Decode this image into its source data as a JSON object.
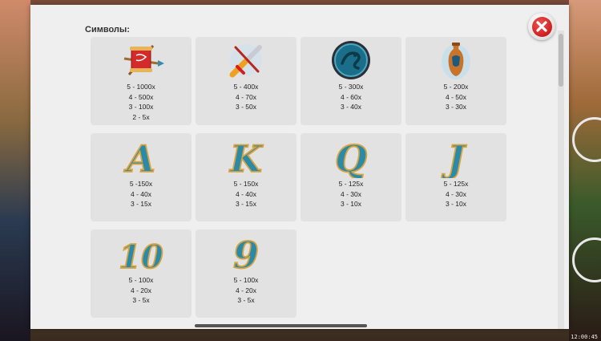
{
  "title": "Символы:",
  "clock": "12:00:45",
  "close_icon": "close-icon",
  "symbols": [
    {
      "name": "scroll-icon",
      "pays": [
        "5 - 1000x",
        "4 - 500x",
        "3 - 100x",
        "2 - 5x"
      ]
    },
    {
      "name": "sword-icon",
      "pays": [
        "5 - 400x",
        "4 - 70x",
        "3 - 50x"
      ]
    },
    {
      "name": "dragon-shield-icon",
      "pays": [
        "5 - 300x",
        "4 - 60x",
        "3 - 40x"
      ]
    },
    {
      "name": "vase-icon",
      "pays": [
        "5 - 200x",
        "4 - 50x",
        "3 - 30x"
      ]
    },
    {
      "name": "letter-a-icon",
      "glyph": "A",
      "pays": [
        "5 -150x",
        "4 - 40x",
        "3 - 15x"
      ]
    },
    {
      "name": "letter-k-icon",
      "glyph": "K",
      "pays": [
        "5 - 150x",
        "4 - 40x",
        "3 - 15x"
      ]
    },
    {
      "name": "letter-q-icon",
      "glyph": "Q",
      "pays": [
        "5 - 125x",
        "4 - 30x",
        "3 - 10x"
      ]
    },
    {
      "name": "letter-j-icon",
      "glyph": "J",
      "pays": [
        "5 - 125x",
        "4 - 30x",
        "3 - 10x"
      ]
    },
    {
      "name": "number-10-icon",
      "glyph": "10",
      "pays": [
        "5 - 100x",
        "4 - 20x",
        "3 - 5x"
      ]
    },
    {
      "name": "number-9-icon",
      "glyph": "9",
      "pays": [
        "5 - 100x",
        "4 - 20x",
        "3 - 5x"
      ]
    }
  ],
  "colors": {
    "panel_bg": "#efefef",
    "card_bg": "#e2e2e2",
    "letter_fill": "#2a8aa8",
    "letter_outline": "#d9a440",
    "close_red": "#cc1f1f"
  }
}
